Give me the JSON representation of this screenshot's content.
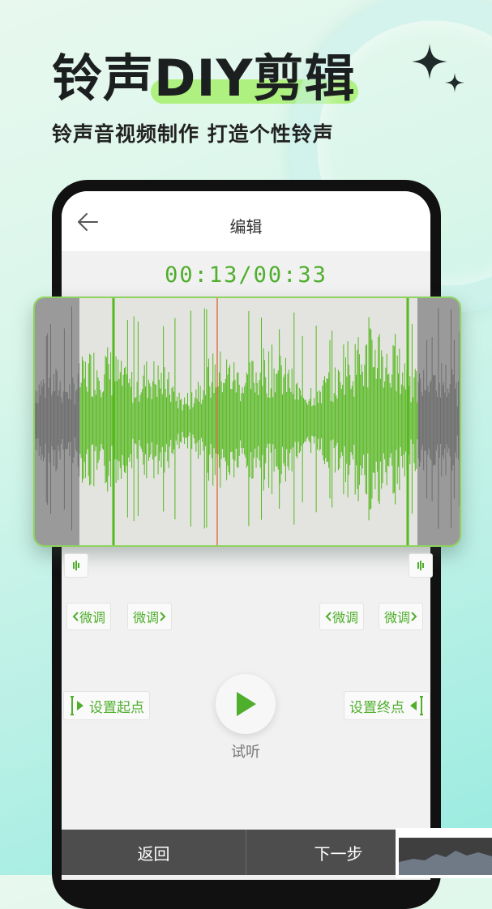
{
  "promo": {
    "headline_part1": "铃声",
    "headline_part2": "DIY剪辑",
    "subtitle": "铃声音视频制作  打造个性铃声"
  },
  "app": {
    "title": "编辑",
    "timecode": "00:13/00:33",
    "controls": {
      "fine_tune_left_1": "微调",
      "fine_tune_left_2": "微调",
      "fine_tune_right_1": "微调",
      "fine_tune_right_2": "微调",
      "set_start": "设置起点",
      "set_end": "设置终点",
      "preview": "试听"
    },
    "bottom": {
      "back": "返回",
      "next": "下一步"
    }
  },
  "icons": [
    "back-arrow-icon",
    "play-icon",
    "marker-icon",
    "chevron-left-icon",
    "chevron-right-icon",
    "start-bracket-icon",
    "end-bracket-icon",
    "sparkle-icon"
  ],
  "colors": {
    "accent_green": "#4fae2c",
    "waveform_green": "#56b91f",
    "highlight_green": "#a6f06c",
    "bottom_bar": "#4d4d4d"
  }
}
